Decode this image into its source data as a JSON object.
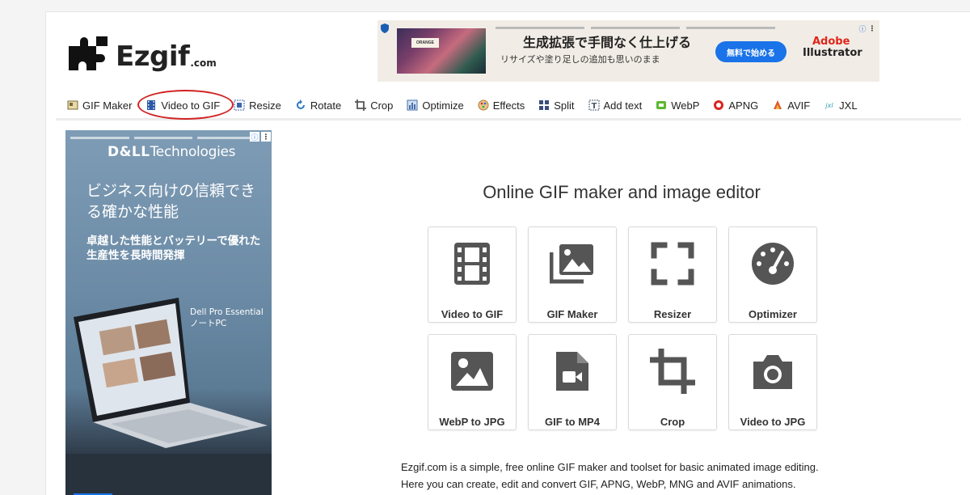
{
  "logo": {
    "name": "Ezgif",
    "suffix": ".com"
  },
  "top_ad": {
    "title": "生成拡張で手間なく仕上げる",
    "subtitle": "リサイズや塗り足しの追加も思いのまま",
    "button": "無料で始める",
    "brand_line1": "Adobe",
    "brand_line2": "Illustrator",
    "thumb_label": "ORANGE"
  },
  "nav": [
    {
      "label": "GIF Maker",
      "icon": "gif-maker-icon",
      "color": "#7a6a3a"
    },
    {
      "label": "Video to GIF",
      "icon": "film-icon",
      "color": "#2b5aa8"
    },
    {
      "label": "Resize",
      "icon": "resize-icon",
      "color": "#3a66b0"
    },
    {
      "label": "Rotate",
      "icon": "rotate-icon",
      "color": "#2f78c4"
    },
    {
      "label": "Crop",
      "icon": "crop-icon",
      "color": "#555555"
    },
    {
      "label": "Optimize",
      "icon": "optimize-icon",
      "color": "#4a6ea8"
    },
    {
      "label": "Effects",
      "icon": "effects-icon",
      "color": "#b07a3a"
    },
    {
      "label": "Split",
      "icon": "split-icon",
      "color": "#3a4f7a"
    },
    {
      "label": "Add text",
      "icon": "add-text-icon",
      "color": "#4a5a6a"
    },
    {
      "label": "WebP",
      "icon": "webp-icon",
      "color": "#5cb832"
    },
    {
      "label": "APNG",
      "icon": "apng-icon",
      "color": "#d8261f"
    },
    {
      "label": "AVIF",
      "icon": "avif-icon",
      "color": "#e0572a"
    },
    {
      "label": "JXL",
      "icon": "jxl-icon",
      "color": "#2aa0b8"
    }
  ],
  "side_ad": {
    "brand_bold": "D&LL",
    "brand_rest": "Technologies",
    "headline": "ビジネス向けの信頼できる確かな性能",
    "subheadline": "卓越した性能とバッテリーで優れた生産性を長時間発揮",
    "model": "Dell Pro Essential ノートPC"
  },
  "main": {
    "title": "Online GIF maker and image editor",
    "tiles": [
      {
        "label": "Video to GIF",
        "icon": "film-icon"
      },
      {
        "label": "GIF Maker",
        "icon": "images-icon"
      },
      {
        "label": "Resizer",
        "icon": "resize-corners-icon"
      },
      {
        "label": "Optimizer",
        "icon": "gauge-icon"
      },
      {
        "label": "WebP to JPG",
        "icon": "image-icon"
      },
      {
        "label": "GIF to MP4",
        "icon": "video-file-icon"
      },
      {
        "label": "Crop",
        "icon": "crop-icon"
      },
      {
        "label": "Video to JPG",
        "icon": "camera-icon"
      }
    ],
    "description_line1": "Ezgif.com is a simple, free online GIF maker and toolset for basic animated image editing.",
    "description_line2": "Here you can create, edit and convert GIF, APNG, WebP, MNG and AVIF animations."
  },
  "colors": {
    "annotation_ring": "#d12323",
    "tile_icon": "#555555",
    "ad_button": "#1a73e8"
  }
}
